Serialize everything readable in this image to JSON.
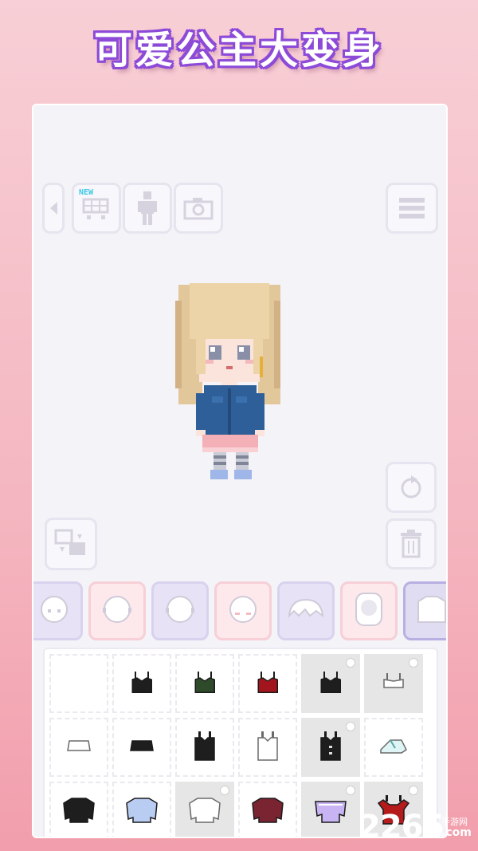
{
  "banner": {
    "title": "可爱公主大变身"
  },
  "toolbar": {
    "new_badge": "NEW",
    "items": [
      {
        "name": "back-arrow",
        "icon": "left-triangle-icon"
      },
      {
        "name": "shop",
        "icon": "cart-icon"
      },
      {
        "name": "body",
        "icon": "person-icon"
      },
      {
        "name": "camera",
        "icon": "camera-icon"
      },
      {
        "name": "menu",
        "icon": "hamburger-icon"
      }
    ]
  },
  "side_buttons": [
    {
      "name": "rotate",
      "icon": "rotate-icon"
    },
    {
      "name": "delete",
      "icon": "trash-icon"
    },
    {
      "name": "swap",
      "icon": "swap-layers-icon"
    }
  ],
  "categories": [
    {
      "id": "face-1",
      "icon": "face-icon",
      "bg": "#e7e2f5",
      "border": "#d9d2ee"
    },
    {
      "id": "face-2",
      "icon": "face-outline-icon",
      "bg": "#fde8ec",
      "border": "#f6cfd7"
    },
    {
      "id": "face-3",
      "icon": "face-outline-icon",
      "bg": "#e7e2f5",
      "border": "#d9d2ee"
    },
    {
      "id": "face-4",
      "icon": "face-blush-icon",
      "bg": "#fde8ec",
      "border": "#f6cfd7"
    },
    {
      "id": "bangs",
      "icon": "bangs-icon",
      "bg": "#e7e2f5",
      "border": "#d9d2ee"
    },
    {
      "id": "back-hair",
      "icon": "back-hair-icon",
      "bg": "#fde8ec",
      "border": "#f6cfd7"
    },
    {
      "id": "tops",
      "icon": "top-icon",
      "bg": "#e0dcf2",
      "border": "#b8b0e2"
    }
  ],
  "items": [
    {
      "icon": "empty-slot-icon",
      "color": "",
      "grey": false,
      "locked": false
    },
    {
      "icon": "camisole-icon",
      "color": "#1e1e1e",
      "grey": false,
      "locked": false
    },
    {
      "icon": "camisole-icon",
      "color": "#2e4a2a",
      "grey": false,
      "locked": false
    },
    {
      "icon": "camisole-icon",
      "color": "#a3151c",
      "grey": false,
      "locked": false
    },
    {
      "icon": "camisole-icon",
      "color": "#1e1e1e",
      "grey": true,
      "locked": true
    },
    {
      "icon": "bralette-icon",
      "color": "#ffffff",
      "grey": true,
      "locked": true
    },
    {
      "icon": "crop-top-icon",
      "color": "#ffffff",
      "grey": false,
      "locked": false
    },
    {
      "icon": "crop-top-icon",
      "color": "#1e1e1e",
      "grey": false,
      "locked": false
    },
    {
      "icon": "tank-icon",
      "color": "#1e1e1e",
      "grey": false,
      "locked": false
    },
    {
      "icon": "tank-icon",
      "color": "#ffffff",
      "grey": false,
      "locked": false
    },
    {
      "icon": "button-tank-icon",
      "color": "#1e1e1e",
      "grey": true,
      "locked": true
    },
    {
      "icon": "wrap-top-icon",
      "color": "#dff4f4",
      "grey": false,
      "locked": false
    },
    {
      "icon": "sweater-icon",
      "color": "#1e1e1e",
      "grey": false,
      "locked": false
    },
    {
      "icon": "sweater-icon",
      "color": "#b9cdf2",
      "grey": false,
      "locked": false
    },
    {
      "icon": "sweater-icon",
      "color": "#ffffff",
      "grey": true,
      "locked": true
    },
    {
      "icon": "sweater-icon",
      "color": "#7a2432",
      "grey": false,
      "locked": false
    },
    {
      "icon": "offshoulder-icon",
      "color": "#c8b4f2",
      "grey": true,
      "locked": true
    },
    {
      "icon": "ruffle-top-icon",
      "color": "#b51b1b",
      "grey": true,
      "locked": true
    }
  ],
  "watermark": {
    "number": "2265",
    "site_cn": "手游网",
    "site": ".com"
  }
}
